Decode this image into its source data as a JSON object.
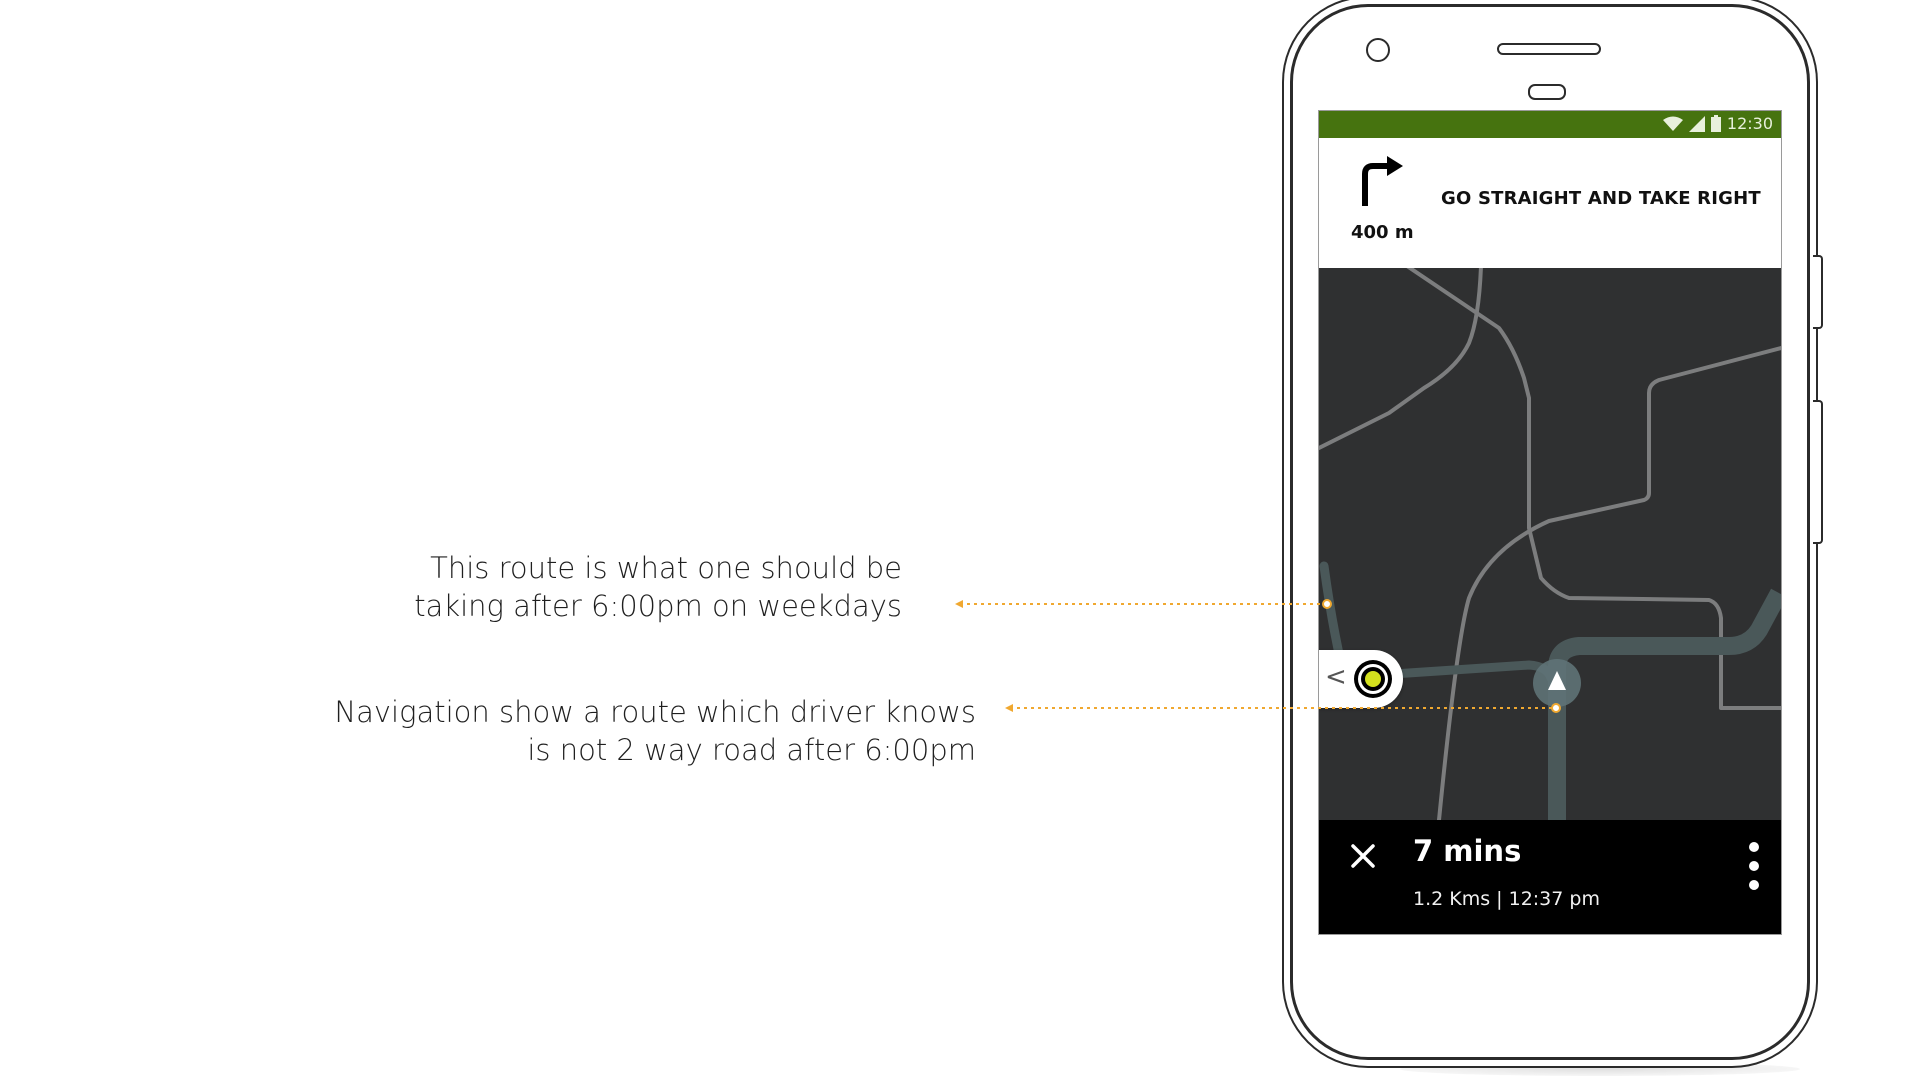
{
  "annotations": {
    "note_1": {
      "line_1": "This route is what one should be",
      "line_2": "taking after 6:00pm on weekdays"
    },
    "note_2": {
      "line_1": "Navigation show a route which driver knows",
      "line_2": "is not 2 way road after 6:00pm"
    }
  },
  "phone": {
    "status_bar": {
      "time": "12:30",
      "icons": [
        "wifi-icon",
        "signal-icon",
        "battery-icon"
      ],
      "color": "#46730f"
    },
    "navigation": {
      "turn_icon": "turn-right-arrow-icon",
      "distance": "400 m",
      "instruction": "GO STRAIGHT AND TAKE RIGHT"
    },
    "map": {
      "drawer_chevron": "<",
      "location_marker_color": "#d4e11e",
      "route_color": "#4a5859"
    },
    "bottom_bar": {
      "close_icon": "close-icon",
      "eta": "7 mins",
      "trip_info": "1.2 Kms | 12:37 pm",
      "menu_icon": "more-vertical-icon"
    }
  },
  "colors": {
    "annotation_leader": "#f0a830",
    "map_background": "#2f3031",
    "map_roads": "#7c7d7e"
  }
}
